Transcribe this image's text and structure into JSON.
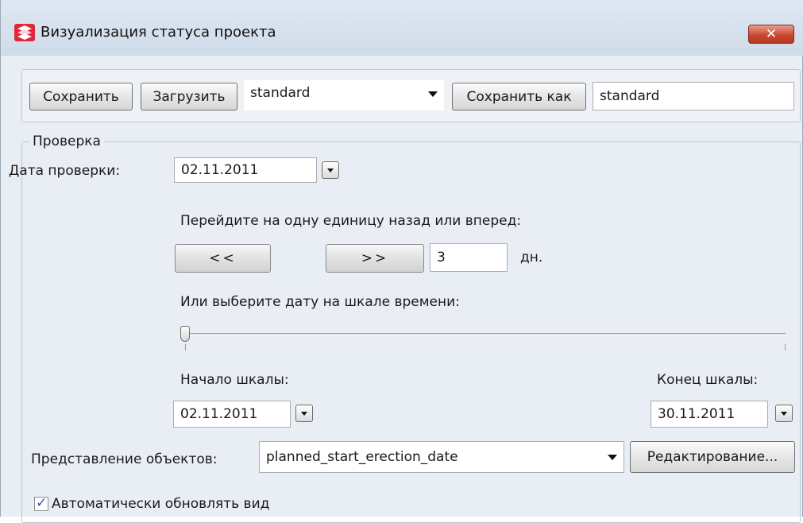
{
  "window": {
    "title": "Визуализация статуса проекта",
    "close_glyph": "✕",
    "app_icon": "app-logo-icon"
  },
  "toolbar": {
    "save_label": "Сохранить",
    "load_label": "Загрузить",
    "preset_value": "standard",
    "save_as_label": "Сохранить как",
    "save_as_value": "standard"
  },
  "check_group": {
    "title": "Проверка",
    "date_label": "Дата проверки:",
    "date_value": "02.11.2011",
    "step_hint": "Перейдите на одну единицу назад или вперед:",
    "back_label": "<<",
    "forward_label": ">>",
    "step_value": "3",
    "step_unit": "дн.",
    "timeline_hint": "Или выберите дату на шкале времени:",
    "slider_position": 0,
    "scale_start_label": "Начало шкалы:",
    "scale_start_value": "02.11.2011",
    "scale_end_label": "Конец шкалы:",
    "scale_end_value": "30.11.2011"
  },
  "objects": {
    "label": "Представление объектов:",
    "value": "planned_start_erection_date",
    "edit_label": "Редактирование..."
  },
  "auto_update": {
    "label": "Автоматически обновлять вид",
    "checked": true
  },
  "colors": {
    "window_bg": "#e9eef5",
    "close_red": "#c94a31",
    "check_blue": "#2a5fa8"
  }
}
